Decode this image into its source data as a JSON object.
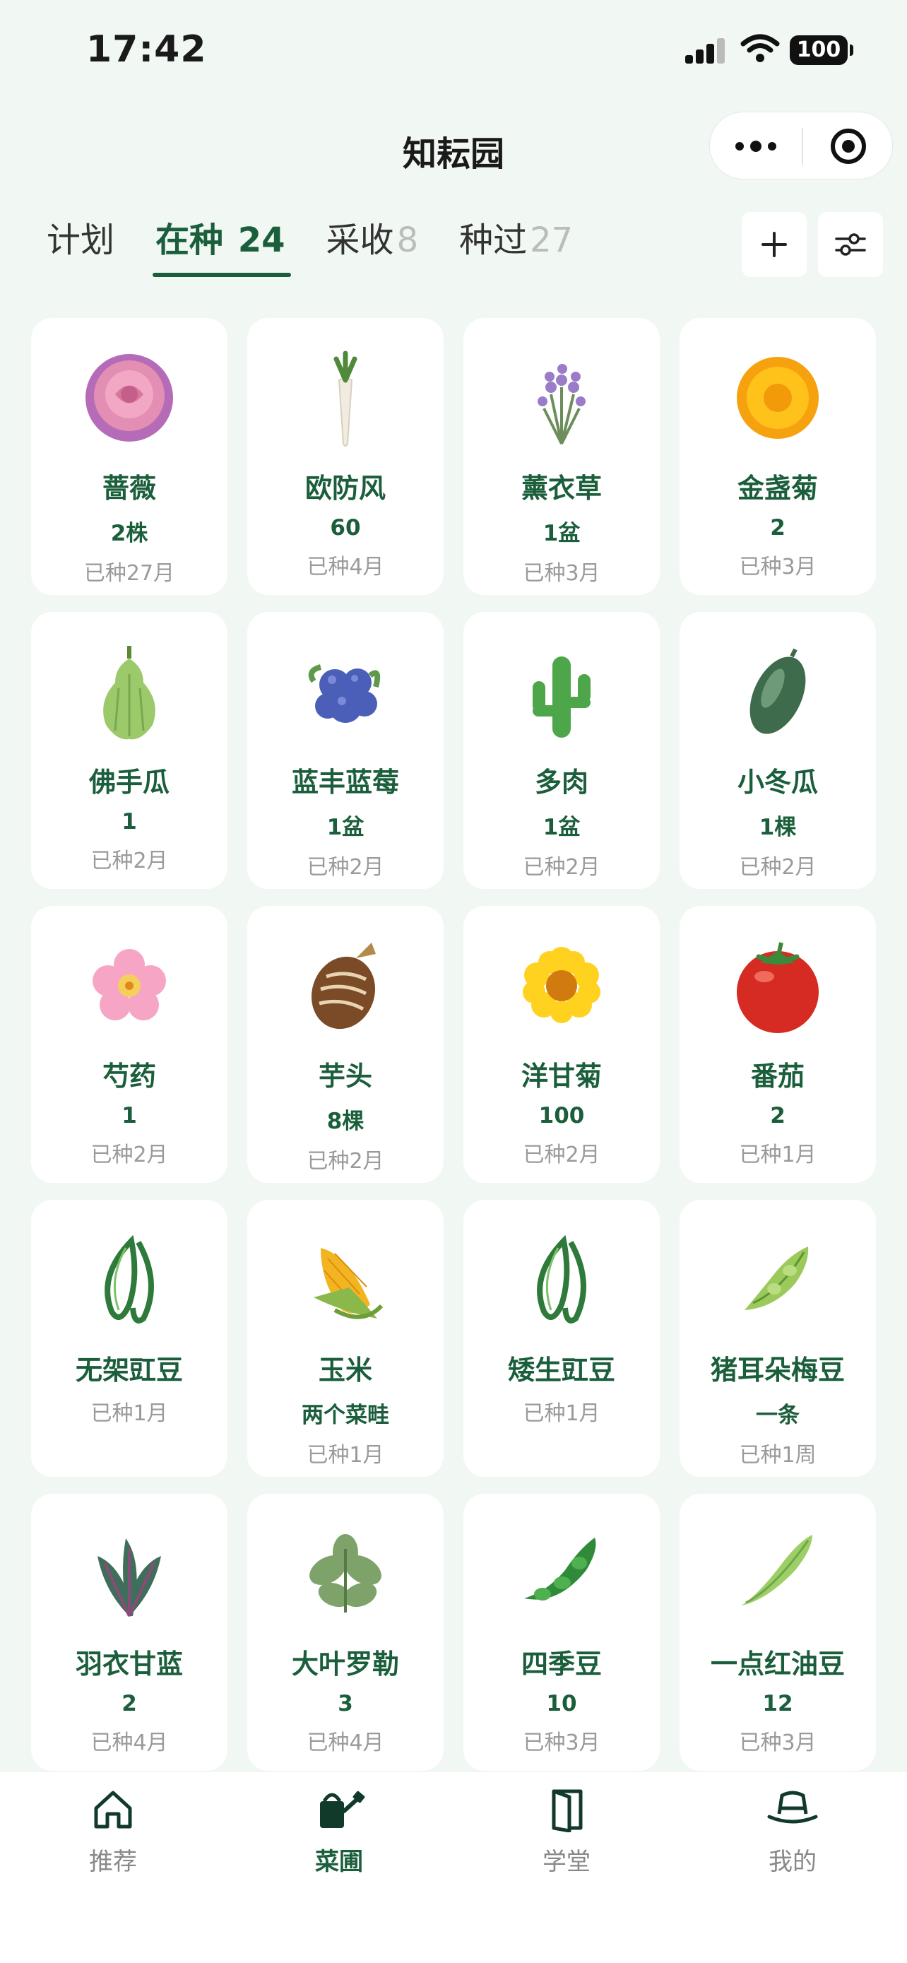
{
  "status_bar": {
    "time": "17:42",
    "battery": "100"
  },
  "nav": {
    "title": "知耘园"
  },
  "tabs": [
    {
      "label": "计划",
      "count": "",
      "active": false
    },
    {
      "label": "在种",
      "count": "24",
      "active": true
    },
    {
      "label": "采收",
      "count": "8",
      "active": false
    },
    {
      "label": "种过",
      "count": "27",
      "active": false
    }
  ],
  "plants": [
    {
      "name": "蔷薇",
      "qty": "2株",
      "age": "已种27月",
      "icon": "rose-icon"
    },
    {
      "name": "欧防风",
      "qty": "60",
      "age": "已种4月",
      "icon": "parsnip-icon"
    },
    {
      "name": "薰衣草",
      "qty": "1盆",
      "age": "已种3月",
      "icon": "lavender-icon"
    },
    {
      "name": "金盏菊",
      "qty": "2",
      "age": "已种3月",
      "icon": "calendula-icon"
    },
    {
      "name": "佛手瓜",
      "qty": "1",
      "age": "已种2月",
      "icon": "chayote-icon"
    },
    {
      "name": "蓝丰蓝莓",
      "qty": "1盆",
      "age": "已种2月",
      "icon": "blueberry-icon"
    },
    {
      "name": "多肉",
      "qty": "1盆",
      "age": "已种2月",
      "icon": "cactus-icon"
    },
    {
      "name": "小冬瓜",
      "qty": "1棵",
      "age": "已种2月",
      "icon": "winter-melon-icon"
    },
    {
      "name": "芍药",
      "qty": "1",
      "age": "已种2月",
      "icon": "peony-icon"
    },
    {
      "name": "芋头",
      "qty": "8棵",
      "age": "已种2月",
      "icon": "taro-icon"
    },
    {
      "name": "洋甘菊",
      "qty": "100",
      "age": "已种2月",
      "icon": "chamomile-icon"
    },
    {
      "name": "番茄",
      "qty": "2",
      "age": "已种1月",
      "icon": "tomato-icon"
    },
    {
      "name": "无架豇豆",
      "qty": "",
      "age": "已种1月",
      "icon": "cowpea-icon"
    },
    {
      "name": "玉米",
      "qty": "两个菜畦",
      "age": "已种1月",
      "icon": "corn-icon"
    },
    {
      "name": "矮生豇豆",
      "qty": "",
      "age": "已种1月",
      "icon": "cowpea-icon"
    },
    {
      "name": "猪耳朵梅豆",
      "qty": "一条",
      "age": "已种1周",
      "icon": "flat-bean-icon"
    },
    {
      "name": "羽衣甘蓝",
      "qty": "2",
      "age": "已种4月",
      "icon": "kale-icon"
    },
    {
      "name": "大叶罗勒",
      "qty": "3",
      "age": "已种4月",
      "icon": "basil-icon"
    },
    {
      "name": "四季豆",
      "qty": "10",
      "age": "已种3月",
      "icon": "green-bean-icon"
    },
    {
      "name": "一点红油豆",
      "qty": "12",
      "age": "已种3月",
      "icon": "pea-pod-icon"
    }
  ],
  "tabbar": [
    {
      "label": "推荐",
      "icon": "home-icon",
      "active": false
    },
    {
      "label": "菜圃",
      "icon": "watering-can-icon",
      "active": true
    },
    {
      "label": "学堂",
      "icon": "book-icon",
      "active": false
    },
    {
      "label": "我的",
      "icon": "hat-icon",
      "active": false
    }
  ],
  "colors": {
    "accent": "#1b5e3b",
    "background": "#f1f7f2",
    "muted": "#9a9a9a"
  }
}
